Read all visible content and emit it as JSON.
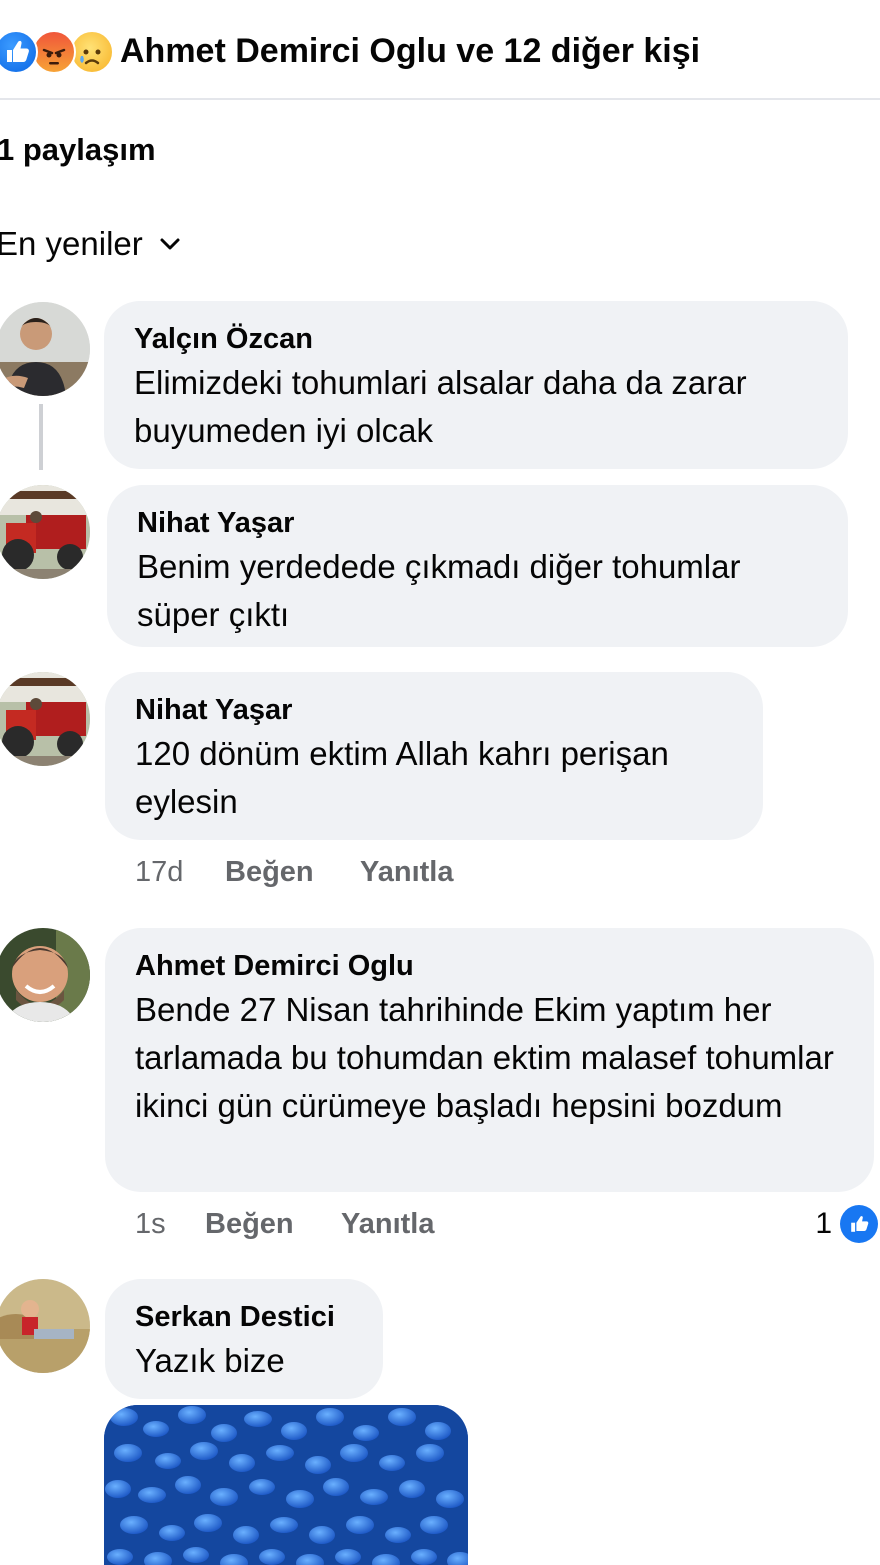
{
  "reactions": {
    "summary": "Ahmet Demirci Oglu ve 12 diğer kişi",
    "icons": [
      "like-icon",
      "angry-icon",
      "sad-icon"
    ]
  },
  "shares": "1 paylaşım",
  "sort_label": "En yeniler",
  "comments": [
    {
      "author": "Yalçın Özcan",
      "text": "Elimizdeki tohumlari alsalar daha da zarar buyumeden iyi olcak"
    },
    {
      "author": "Nihat Yaşar",
      "text": "Benim yerdedede çıkmadı diğer tohumlar süper çıktı"
    },
    {
      "author": "Nihat Yaşar",
      "text": "120 dönüm ektim Allah kahrı perişan eylesin",
      "time": "17d",
      "like_label": "Beğen",
      "reply_label": "Yanıtla"
    },
    {
      "author": "Ahmet Demirci Oglu",
      "text": "Bende 27 Nisan tahrihinde Ekim yaptım her tarlamada bu tohumdan ektim malasef tohumlar ikinci gün cürümeye başladı hepsini bozdum",
      "time": "1s",
      "like_label": "Beğen",
      "reply_label": "Yanıtla",
      "like_count": "1"
    },
    {
      "author": "Serkan Destici",
      "text": "Yazık bize"
    }
  ],
  "colors": {
    "bubble": "#f0f2f5",
    "meta_text": "#65676b",
    "brand_blue": "#1877f2",
    "divider": "#e4e6eb"
  }
}
